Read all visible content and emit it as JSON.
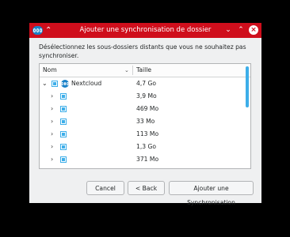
{
  "window": {
    "title": "Ajouter une synchronisation de dossier",
    "pin_glyph": "⌃",
    "minimize_glyph": "⌄",
    "maximize_glyph": "⌃",
    "close_glyph": "×",
    "accent_color": "#cf0e1c"
  },
  "description": "Désélectionnez les sous-dossiers distants que vous ne souhaitez pas synchroniser.",
  "tree": {
    "columns": {
      "name": "Nom",
      "size": "Taille",
      "sort_glyph": "⌄"
    },
    "root": {
      "name": "Nextcloud",
      "size": "4,7 Go",
      "expand_glyph": "⌄"
    },
    "children": [
      {
        "name": "",
        "size": "3,9 Mo",
        "expand_glyph": "›"
      },
      {
        "name": "",
        "size": "469 Mo",
        "expand_glyph": "›"
      },
      {
        "name": "",
        "size": "33 Mo",
        "expand_glyph": "›"
      },
      {
        "name": "",
        "size": "113 Mo",
        "expand_glyph": "›"
      },
      {
        "name": "",
        "size": "1,3 Go",
        "expand_glyph": "›"
      },
      {
        "name": "",
        "size": "371 Mo",
        "expand_glyph": "›"
      }
    ]
  },
  "buttons": {
    "cancel": "Cancel",
    "back": "< Back",
    "add": "Ajouter une Synchronisation"
  }
}
